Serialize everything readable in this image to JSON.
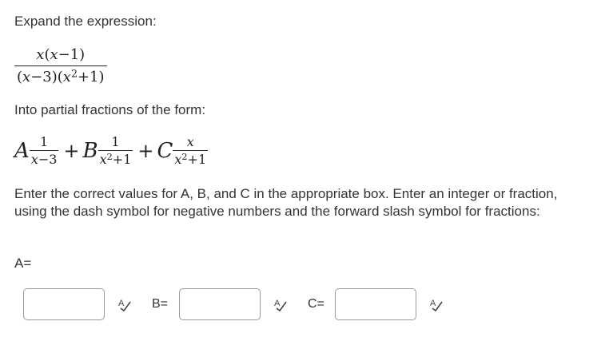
{
  "prompt": "Expand the expression:",
  "expression": {
    "numerator": "x(x−1)",
    "denominator": "(x−3)(x²+1)"
  },
  "form_intro": "Into partial fractions of the form:",
  "form": {
    "term_a": {
      "coef": "A",
      "num": "1",
      "den": "x−3"
    },
    "plus1": "+",
    "term_b": {
      "coef": "B",
      "num": "1",
      "den": "x²+1"
    },
    "plus2": "+",
    "term_c": {
      "coef": "C",
      "num": "x",
      "den": "x²+1"
    }
  },
  "instructions": "Enter the correct values for A, B, and C in the appropriate box. Enter an integer or fraction, using the dash symbol for negative numbers and the forward slash symbol for fractions:",
  "answers": {
    "a_label": "A=",
    "b_label": "B=",
    "c_label": "C=",
    "a_value": "",
    "b_value": "",
    "c_value": ""
  },
  "icons": {
    "spellcheck": "spellcheck-icon"
  }
}
